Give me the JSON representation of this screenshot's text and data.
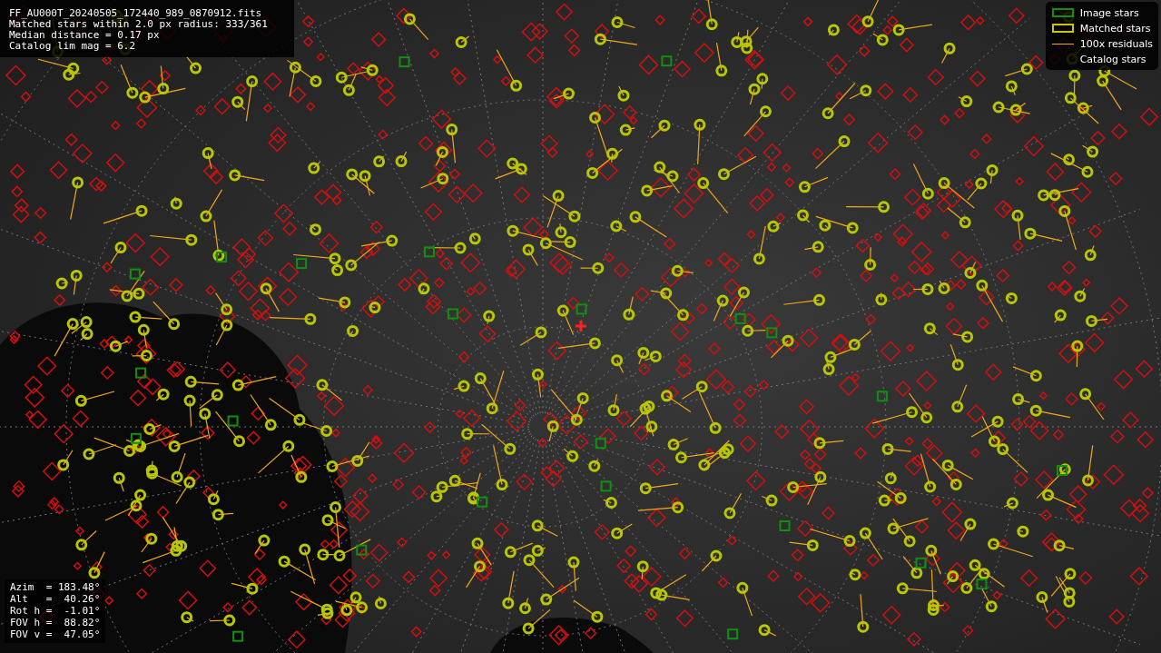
{
  "info_panel": {
    "lines": [
      "FF_AU000T_20240505_172440_989_0870912.fits",
      "Matched stars within 2.0 px radius: 333/361",
      "Median distance = 0.17 px",
      "Catalog lim mag = 6.2"
    ]
  },
  "legend": [
    {
      "kind": "image",
      "label": "Image stars"
    },
    {
      "kind": "matched",
      "label": "Matched stars"
    },
    {
      "kind": "residual",
      "label": "100x residuals"
    },
    {
      "kind": "catalog",
      "label": "Catalog stars"
    }
  ],
  "pointing": [
    "Azim  = 183.48°",
    "Alt   =  40.26°",
    "Rot h =  -1.01°",
    "FOV h =  88.82°",
    "FOV v =  47.05°"
  ]
}
